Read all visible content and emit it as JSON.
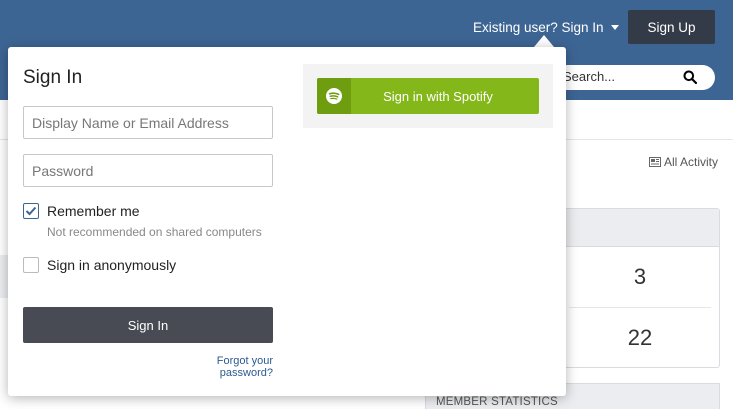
{
  "header": {
    "existing_user_label": "Existing user? Sign In",
    "signup_label": "Sign Up",
    "search_placeholder": "Search..."
  },
  "background": {
    "activity_label": "All Activity",
    "stats": [
      "3",
      "22"
    ],
    "member_stats_label": "MEMBER STATISTICS"
  },
  "signin": {
    "title": "Sign In",
    "username_placeholder": "Display Name or Email Address",
    "password_placeholder": "Password",
    "remember_label": "Remember me",
    "remember_checked": true,
    "remember_note": "Not recommended on shared computers",
    "anonymous_label": "Sign in anonymously",
    "anonymous_checked": false,
    "submit_label": "Sign In",
    "forgot_label": "Forgot your password?",
    "spotify_label": "Sign in with Spotify"
  },
  "colors": {
    "header_bg": "#3d6594",
    "signup_bg": "#333b48",
    "spotify_green": "#84b719",
    "submit_bg": "#484b54",
    "link": "#2b5a8f"
  },
  "icons": {
    "caret": "caret-down-icon",
    "search": "search-icon",
    "activity": "newspaper-icon",
    "spotify": "spotify-icon",
    "check": "checkmark-icon"
  }
}
